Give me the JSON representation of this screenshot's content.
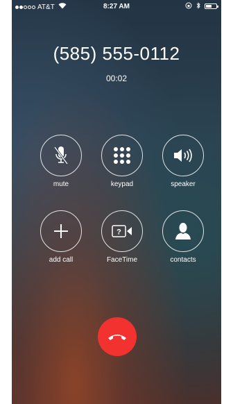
{
  "status_bar": {
    "carrier": "AT&T",
    "time": "8:27 AM",
    "signal_bars_on": 2,
    "signal_bars_total": 5,
    "battery_level": 0.6
  },
  "call": {
    "number": "(585) 555-0112",
    "duration": "00:02"
  },
  "controls": [
    {
      "label": "mute",
      "icon": "mic-off-icon"
    },
    {
      "label": "keypad",
      "icon": "keypad-icon"
    },
    {
      "label": "speaker",
      "icon": "speaker-icon"
    },
    {
      "label": "add call",
      "icon": "plus-icon"
    },
    {
      "label": "FaceTime",
      "icon": "facetime-icon"
    },
    {
      "label": "contacts",
      "icon": "contact-icon"
    }
  ],
  "end_call": {
    "icon": "hang-up-icon",
    "color": "#f2322f"
  }
}
